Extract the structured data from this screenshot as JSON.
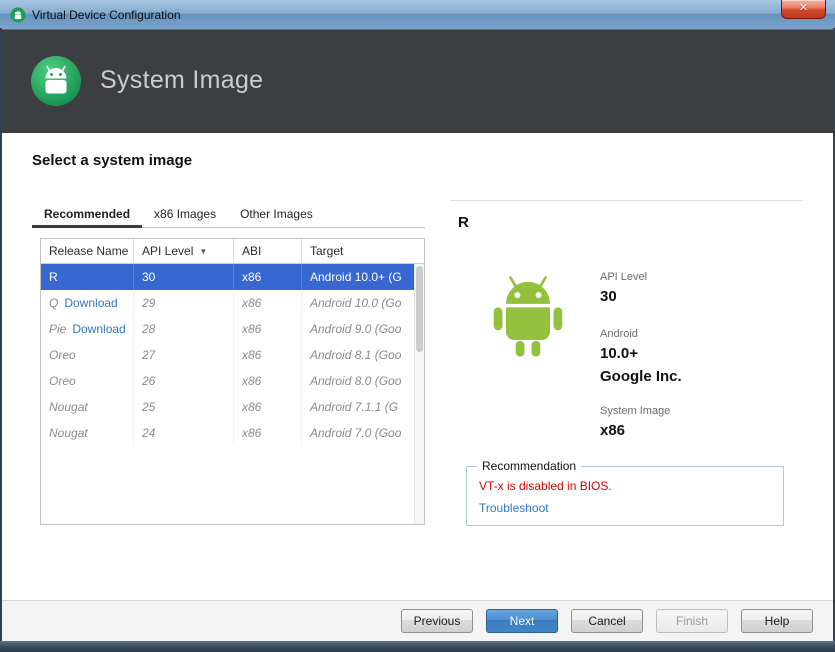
{
  "window": {
    "title": "Virtual Device Configuration",
    "close": "✕"
  },
  "header": {
    "title": "System Image"
  },
  "main": {
    "heading": "Select a system image",
    "tabs": [
      {
        "label": "Recommended"
      },
      {
        "label": "x86 Images"
      },
      {
        "label": "Other Images"
      }
    ],
    "table": {
      "columns": [
        {
          "label": "Release Name"
        },
        {
          "label": "API Level"
        },
        {
          "label": "ABI"
        },
        {
          "label": "Target"
        }
      ],
      "sort_icon": "▼",
      "download_label": "Download",
      "rows": [
        {
          "release": "R",
          "api": "30",
          "abi": "x86",
          "target": "Android 10.0+ (G"
        },
        {
          "release": "Q",
          "api": "29",
          "abi": "x86",
          "target": "Android 10.0 (Go"
        },
        {
          "release": "Pie",
          "api": "28",
          "abi": "x86",
          "target": "Android 9.0 (Goo"
        },
        {
          "release": "Oreo",
          "api": "27",
          "abi": "x86",
          "target": "Android 8.1 (Goo"
        },
        {
          "release": "Oreo",
          "api": "26",
          "abi": "x86",
          "target": "Android 8.0 (Goo"
        },
        {
          "release": "Nougat",
          "api": "25",
          "abi": "x86",
          "target": "Android 7.1.1 (G"
        },
        {
          "release": "Nougat",
          "api": "24",
          "abi": "x86",
          "target": "Android 7.0 (Goo"
        }
      ]
    },
    "details": {
      "title": "R",
      "api_label": "API Level",
      "api_value": "30",
      "android_label": "Android",
      "android_value": "10.0+",
      "vendor": "Google Inc.",
      "image_label": "System Image",
      "image_value": "x86"
    },
    "recommendation": {
      "title": "Recommendation",
      "warning": "VT-x is disabled in BIOS.",
      "link": "Troubleshoot"
    }
  },
  "footer": {
    "buttons": [
      {
        "label": "Previous"
      },
      {
        "label": "Next"
      },
      {
        "label": "Cancel"
      },
      {
        "label": "Finish"
      },
      {
        "label": "Help"
      }
    ]
  },
  "colors": {
    "selection_blue": "#3767d0",
    "android_green": "#93c13e",
    "error_red": "#cc0606",
    "link_blue": "#2d76c7",
    "header_dark": "#3c3f41"
  }
}
